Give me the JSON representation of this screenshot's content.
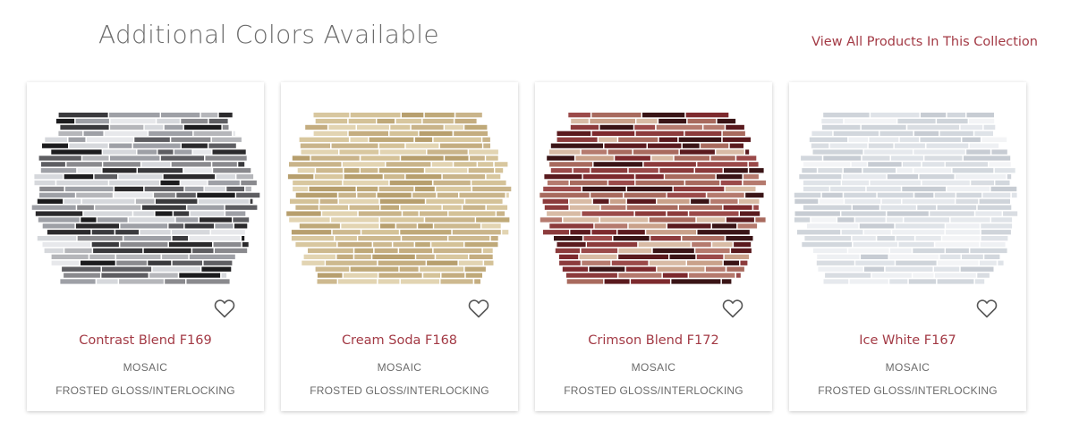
{
  "section": {
    "title": "Additional Colors Available",
    "view_all_label": "View All Products In This Collection"
  },
  "products": [
    {
      "name": "Contrast Blend F169",
      "type": "MOSAIC",
      "finish": "FROSTED GLOSS/INTERLOCKING",
      "favorite_icon": "heart-outline-icon",
      "palette": [
        "#1c1c1e",
        "#3a3a3d",
        "#5e5e62",
        "#8a8a8e",
        "#b5b6ba",
        "#d6d8dc",
        "#2b2a2c",
        "#9ea0a6",
        "#e7e8eb"
      ]
    },
    {
      "name": "Cream Soda F168",
      "type": "MOSAIC",
      "finish": "FROSTED GLOSS/INTERLOCKING",
      "favorite_icon": "heart-outline-icon",
      "palette": [
        "#c9b48a",
        "#d8c79f",
        "#bfa979",
        "#e2d4b2",
        "#cdb98f",
        "#b79f6e",
        "#d4c298",
        "#c4ad80"
      ]
    },
    {
      "name": "Crimson Blend F172",
      "type": "MOSAIC",
      "finish": "FROSTED GLOSS/INTERLOCKING",
      "favorite_icon": "heart-outline-icon",
      "palette": [
        "#5a1a1e",
        "#7d2a2e",
        "#9b4a4a",
        "#b57a6e",
        "#c9a18a",
        "#3a1416",
        "#a86a5e",
        "#d8bba5",
        "#8c3b3c"
      ]
    },
    {
      "name": "Ice White F167",
      "type": "MOSAIC",
      "finish": "FROSTED GLOSS/INTERLOCKING",
      "favorite_icon": "heart-outline-icon",
      "palette": [
        "#d9dde2",
        "#e6e9ed",
        "#cfd4da",
        "#eef0f3",
        "#c7ccd3",
        "#dfe3e8",
        "#f3f4f6",
        "#d2d7dd"
      ]
    }
  ]
}
